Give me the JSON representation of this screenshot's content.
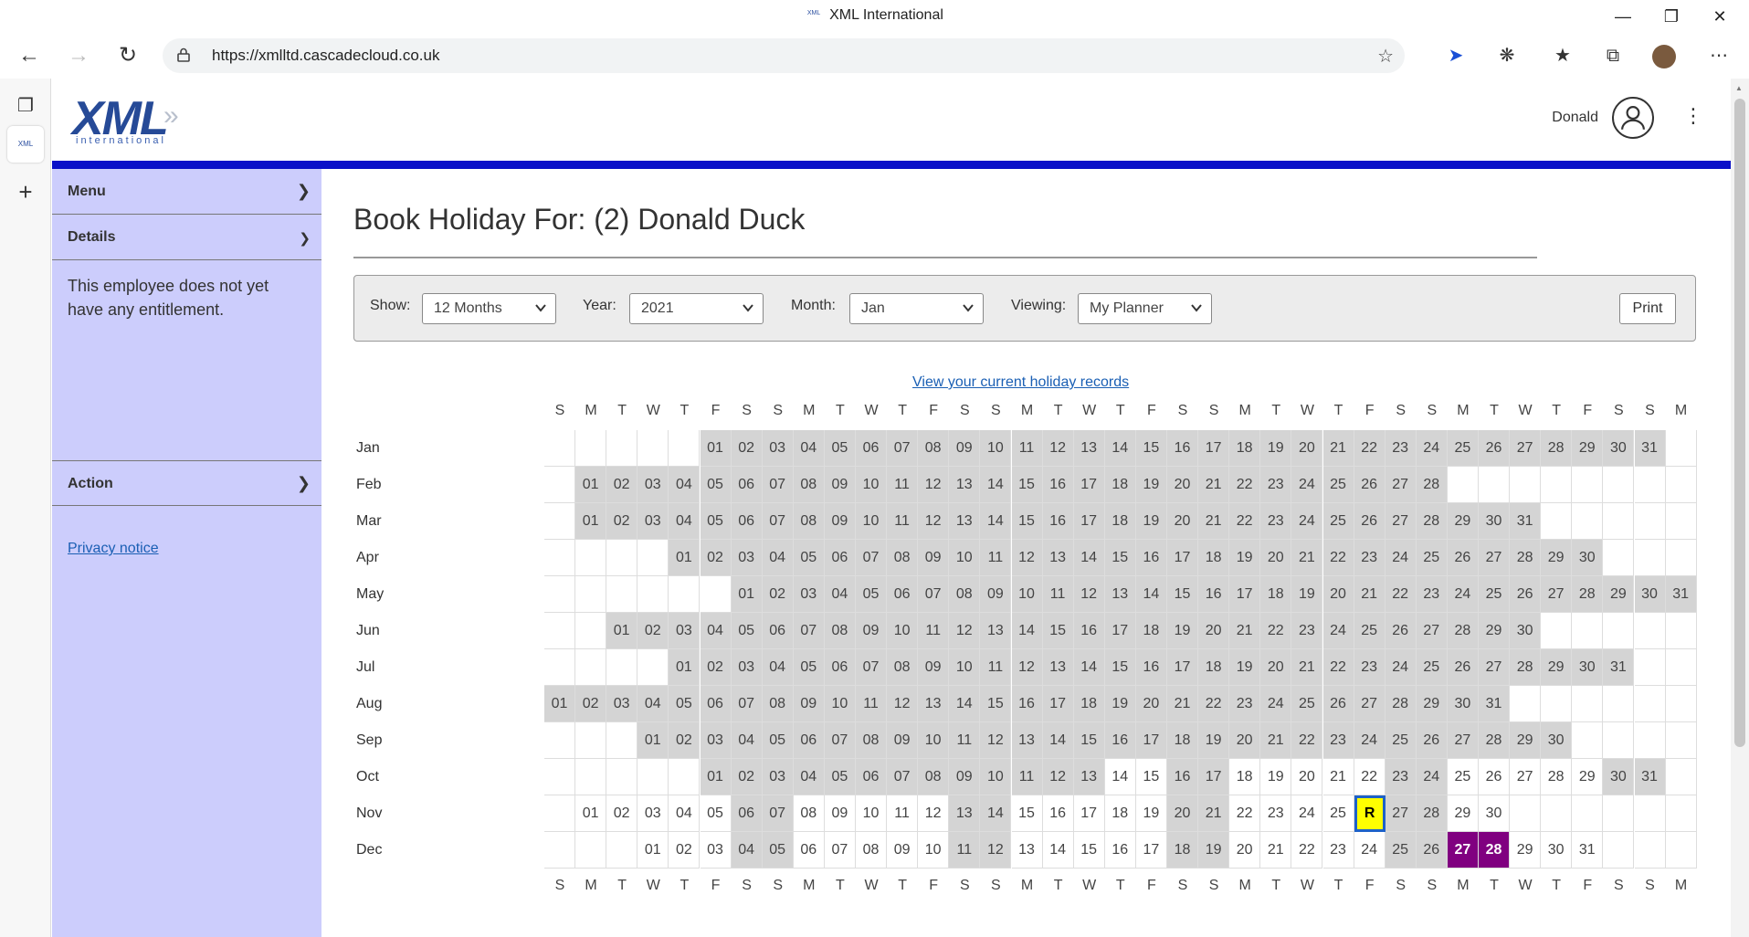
{
  "browser": {
    "window_title": "XML International",
    "favicon_text": "XML",
    "url": "https://xmlltd.cascadecloud.co.uk",
    "tab_favicon_text": "XML"
  },
  "header": {
    "logo_main": "XML",
    "logo_sub": "international",
    "user_name": "Donald"
  },
  "sidebar": {
    "menu_label": "Menu",
    "details_label": "Details",
    "details_text": "This employee does not yet have any entitlement.",
    "action_label": "Action",
    "privacy_link": "Privacy notice"
  },
  "main": {
    "title": "Book Holiday For: (2) Donald Duck",
    "records_link": "View your current holiday records"
  },
  "filters": {
    "show_label": "Show:",
    "show_value": "12 Months",
    "year_label": "Year:",
    "year_value": "2021",
    "month_label": "Month:",
    "month_value": "Jan",
    "viewing_label": "Viewing:",
    "viewing_value": "My Planner",
    "print_label": "Print"
  },
  "calendar": {
    "weekday_headers": [
      "S",
      "M",
      "T",
      "W",
      "T",
      "F",
      "S",
      "S",
      "M",
      "T",
      "W",
      "T",
      "F",
      "S",
      "S",
      "M",
      "T",
      "W",
      "T",
      "F",
      "S",
      "S",
      "M",
      "T",
      "W",
      "T",
      "F",
      "S",
      "S",
      "M",
      "T",
      "W",
      "T",
      "F",
      "S",
      "S",
      "M"
    ],
    "months": [
      {
        "name": "Jan",
        "offset": 5,
        "days": 31,
        "unshaded": []
      },
      {
        "name": "Feb",
        "offset": 1,
        "days": 28,
        "unshaded": []
      },
      {
        "name": "Mar",
        "offset": 1,
        "days": 31,
        "unshaded": []
      },
      {
        "name": "Apr",
        "offset": 4,
        "days": 30,
        "unshaded": []
      },
      {
        "name": "May",
        "offset": 6,
        "days": 31,
        "unshaded": []
      },
      {
        "name": "Jun",
        "offset": 2,
        "days": 30,
        "unshaded": []
      },
      {
        "name": "Jul",
        "offset": 4,
        "days": 31,
        "unshaded": []
      },
      {
        "name": "Aug",
        "offset": 0,
        "days": 31,
        "unshaded": []
      },
      {
        "name": "Sep",
        "offset": 3,
        "days": 30,
        "unshaded": []
      },
      {
        "name": "Oct",
        "offset": 5,
        "days": 31,
        "unshaded": [
          14,
          15,
          18,
          19,
          20,
          21,
          22,
          25,
          26,
          27,
          28,
          29
        ]
      },
      {
        "name": "Nov",
        "offset": 1,
        "days": 30,
        "unshaded": [
          1,
          2,
          3,
          4,
          5,
          8,
          9,
          10,
          11,
          12,
          15,
          16,
          17,
          18,
          19,
          22,
          23,
          24,
          25,
          26,
          29,
          30
        ]
      },
      {
        "name": "Dec",
        "offset": 3,
        "days": 31,
        "unshaded": [
          1,
          2,
          3,
          6,
          7,
          8,
          9,
          10,
          13,
          14,
          15,
          16,
          17,
          20,
          21,
          22,
          23,
          24,
          29,
          30,
          31
        ]
      }
    ],
    "shaded_extra": {
      "Nov": [
        6,
        7,
        13,
        14,
        20,
        21,
        27,
        28
      ],
      "Dec": [
        4,
        5,
        11,
        12,
        18,
        19,
        25,
        26
      ]
    },
    "booked": {
      "Dec": [
        27,
        28
      ]
    },
    "today": {
      "month": "Nov",
      "day": 26,
      "label": "R"
    },
    "colors": {
      "available": "#d4d4d4",
      "booked": "#800080",
      "today": "#ffff00",
      "today_border": "#1e62c8",
      "accent_bar": "#0a10c8",
      "sidebar_bg": "#cccdfc"
    }
  }
}
